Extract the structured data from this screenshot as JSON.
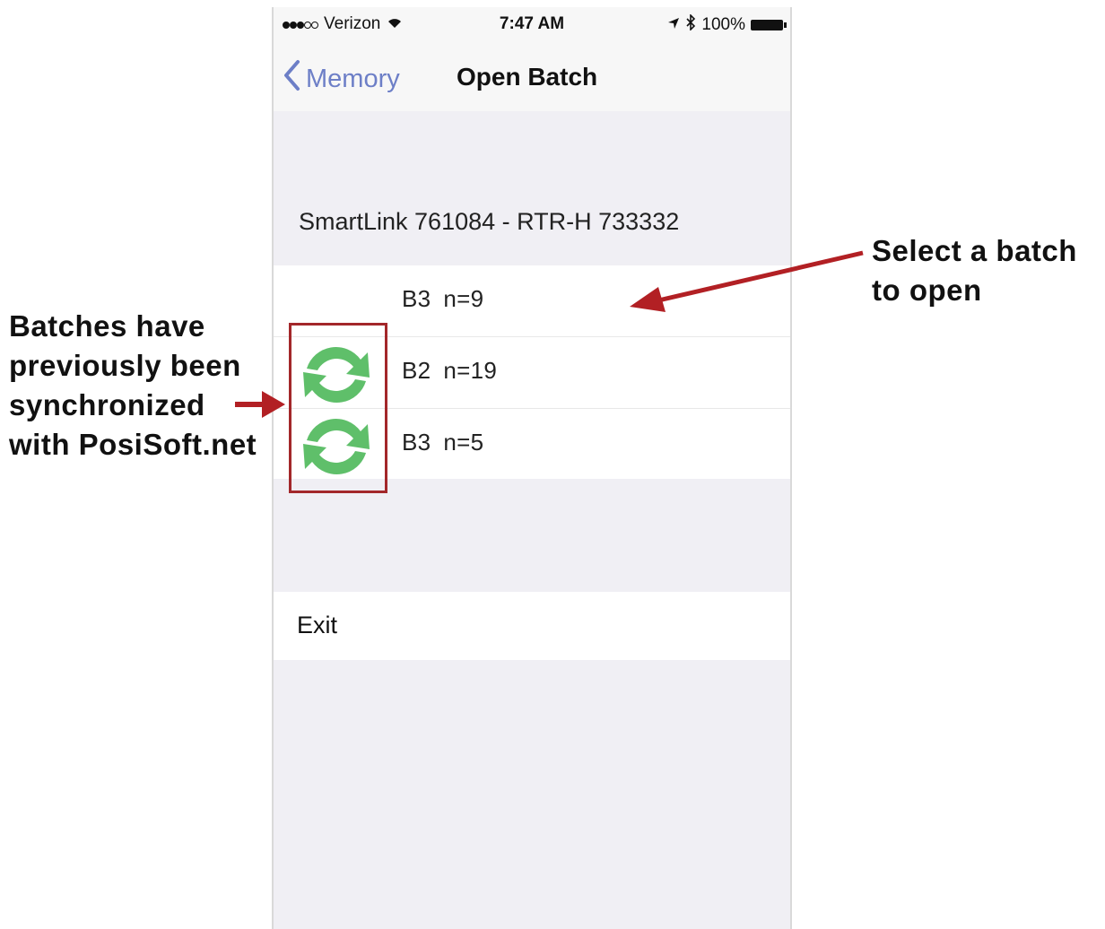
{
  "status_bar": {
    "carrier": "Verizon",
    "time": "7:47 AM",
    "battery": "100%"
  },
  "nav": {
    "back_label": "Memory",
    "title": "Open Batch"
  },
  "device_header": "SmartLink 761084 - RTR-H 733332",
  "batches": [
    {
      "id": "B3",
      "count": "n=9",
      "synced": false
    },
    {
      "id": "B2",
      "count": "n=19",
      "synced": true
    },
    {
      "id": "B3",
      "count": "n=5",
      "synced": true
    }
  ],
  "exit_label": "Exit",
  "annotations": {
    "left_lines": [
      "Batches have",
      "previously been",
      "synchronized",
      "with PosiSoft.net"
    ],
    "right_lines": [
      "Select a batch",
      "to open"
    ],
    "arrow_color": "#b22024",
    "box_color": "#a3272a",
    "sync_icon_color": "#5fbf6a"
  },
  "colors": {
    "accent": "#6d7fc7",
    "background": "#f0eff4"
  }
}
